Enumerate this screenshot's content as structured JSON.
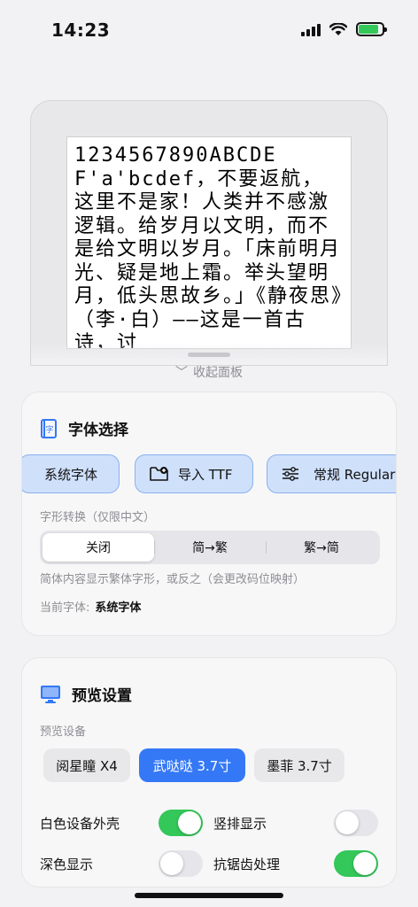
{
  "status": {
    "time": "14:23"
  },
  "preview": {
    "text": "1234567890ABCDEF'a'bcdef，不要返航，这里不是家！人类并不感激逻辑。给岁月以文明，而不是给文明以岁月。「床前明月光、疑是地上霜。举头望明月，低头思故乡。」《静夜思》（李·白）——这是一首古诗，讨"
  },
  "collapse": {
    "label": "收起面板"
  },
  "font_card": {
    "title": "字体选择",
    "chips": {
      "system": "系统字体",
      "import": "导入 TTF",
      "weight": "常规 Regular"
    },
    "convert_label": "字形转换（仅限中文）",
    "segments": {
      "off": "关闭",
      "s2t": "简→繁",
      "t2s": "繁→简"
    },
    "hint": "简体内容显示繁体字形，或反之（会更改码位映射）",
    "current_label": "当前字体:",
    "current_value": "系统字体"
  },
  "preview_card": {
    "title": "预览设置",
    "device_label": "预览设备",
    "devices": {
      "x4": "阅星瞳 X4",
      "wudada": "武哒哒 3.7寸",
      "mofei": "墨菲 3.7寸"
    },
    "toggles": {
      "white_shell": {
        "label": "白色设备外壳",
        "on": true
      },
      "vertical": {
        "label": "竖排显示",
        "on": false
      },
      "dark": {
        "label": "深色显示",
        "on": false
      },
      "antialias": {
        "label": "抗锯齿处理",
        "on": true
      }
    }
  },
  "colors": {
    "accent": "#3478f6",
    "toggle_on": "#34c759",
    "chip_bg": "#cfe0fb"
  }
}
